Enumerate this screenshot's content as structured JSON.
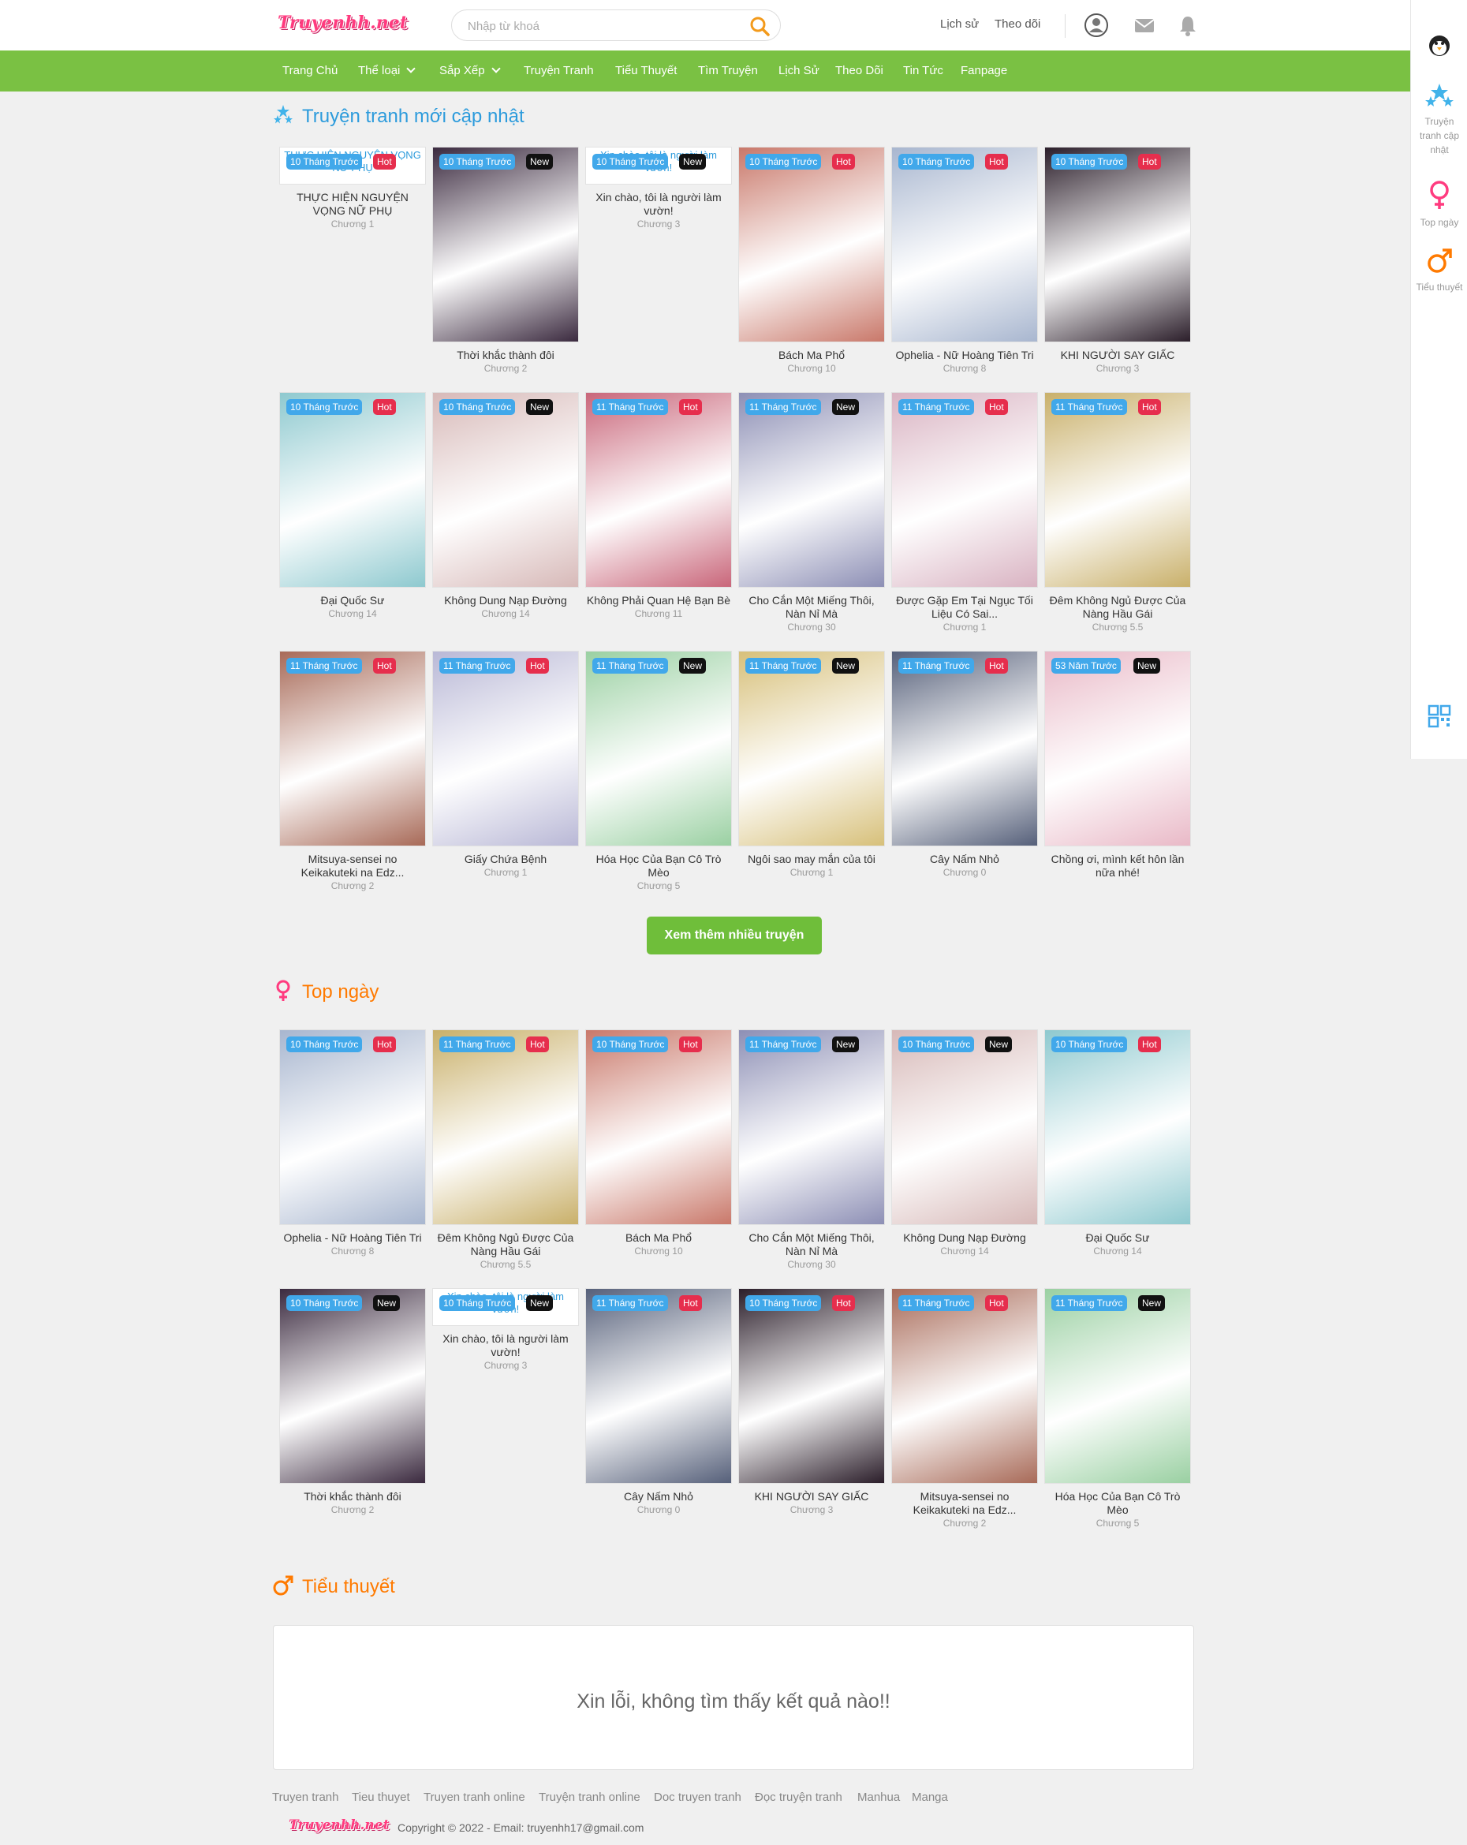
{
  "header": {
    "logo_text": "Truyenhh.net",
    "search_placeholder": "Nhập từ khoá",
    "history_label": "Lịch sử",
    "follow_label": "Theo dõi",
    "icons": [
      "user-icon",
      "mail-icon",
      "bell-icon",
      "search-icon"
    ]
  },
  "nav": {
    "items": [
      {
        "label": "Trang Chủ"
      },
      {
        "label": "Thể loại",
        "dropdown": true
      },
      {
        "label": "Sắp Xếp",
        "dropdown": true
      },
      {
        "label": "Truyện Tranh"
      },
      {
        "label": "Tiểu Thuyết"
      },
      {
        "label": "Tìm Truyện"
      },
      {
        "label": "Lịch Sử"
      },
      {
        "label": "Theo Dõi"
      },
      {
        "label": "Tin Tức"
      },
      {
        "label": "Fanpage"
      }
    ]
  },
  "sidebar": {
    "items": [
      {
        "label": "",
        "icon": "penguin-icon"
      },
      {
        "label": "Truyện tranh cập nhật",
        "icon": "stars-icon"
      },
      {
        "label": "Top ngày",
        "icon": "female-icon"
      },
      {
        "label": "Tiểu thuyết",
        "icon": "male-icon"
      },
      {
        "label": "",
        "icon": "qr-code-icon"
      }
    ]
  },
  "sections": {
    "latest": {
      "title": "Truyện tranh mới cập nhật",
      "more_label": "Xem thêm nhiều truyện"
    },
    "top": {
      "title": "Top ngày"
    },
    "novel": {
      "title": "Tiểu thuyết",
      "empty_message": "Xin lỗi, không tìm thấy kết quả nào!!"
    }
  },
  "latest_cards": [
    {
      "time": "10 Tháng Trước",
      "tag": "Hot",
      "title": "THỰC HIỆN NGUYỆN VỌNG NỮ PHỤ",
      "chapter": "Chương 1",
      "alt": "THỰC HIỆN NGUYỆN VỌNG NỮ PHỤ",
      "broken": true
    },
    {
      "time": "10 Tháng Trước",
      "tag": "New",
      "title": "Thời khắc thành đôi",
      "chapter": "Chương 2",
      "hue": "#3b2a3f"
    },
    {
      "time": "10 Tháng Trước",
      "tag": "New",
      "title": "Xin chào, tôi là người làm vườn!",
      "chapter": "Chương 3",
      "alt": "Xin chào, tôi là người làm vườn!",
      "broken": true
    },
    {
      "time": "10 Tháng Trước",
      "tag": "Hot",
      "title": "Bách Ma Phổ",
      "chapter": "Chương 10",
      "hue": "#c9786a"
    },
    {
      "time": "10 Tháng Trước",
      "tag": "Hot",
      "title": "Ophelia - Nữ Hoàng Tiên Tri",
      "chapter": "Chương 8",
      "hue": "#a8b6cf"
    },
    {
      "time": "10 Tháng Trước",
      "tag": "Hot",
      "title": "KHI NGƯỜI SAY GIẤC",
      "chapter": "Chương 3",
      "hue": "#2b1e2a"
    },
    {
      "time": "10 Tháng Trước",
      "tag": "Hot",
      "title": "Đại Quốc Sư",
      "chapter": "Chương 14",
      "hue": "#8ec9cf"
    },
    {
      "time": "10 Tháng Trước",
      "tag": "New",
      "title": "Không Dung Nạp Đường",
      "chapter": "Chương 14",
      "hue": "#d7b9b8"
    },
    {
      "time": "11 Tháng Trước",
      "tag": "Hot",
      "title": "Không Phải Quan Hệ Bạn Bè",
      "chapter": "Chương 11",
      "hue": "#c9667a"
    },
    {
      "time": "11 Tháng Trước",
      "tag": "New",
      "title": "Cho Cắn Một Miếng Thôi, Nàn Nỉ Mà",
      "chapter": "Chương 30",
      "hue": "#8d8fb5"
    },
    {
      "time": "11 Tháng Trước",
      "tag": "Hot",
      "title": "Được Gặp Em Tại Ngục Tối Liệu Có Sai...",
      "chapter": "Chương 1",
      "hue": "#d9b3c2"
    },
    {
      "time": "11 Tháng Trước",
      "tag": "Hot",
      "title": "Đêm Không Ngủ Được Của Nàng Hầu Gái",
      "chapter": "Chương 5.5",
      "hue": "#c9b06a"
    },
    {
      "time": "11 Tháng Trước",
      "tag": "Hot",
      "title": "Mitsuya-sensei no Keikakuteki na Edz...",
      "chapter": "Chương 2",
      "hue": "#a86a58"
    },
    {
      "time": "11 Tháng Trước",
      "tag": "Hot",
      "title": "Giấy Chứa Bệnh",
      "chapter": "Chương 1",
      "hue": "#b9b8d6"
    },
    {
      "time": "11 Tháng Trước",
      "tag": "New",
      "title": "Hóa Học Của Bạn Cô Trò Mèo",
      "chapter": "Chương 5",
      "hue": "#9ad0a2"
    },
    {
      "time": "11 Tháng Trước",
      "tag": "New",
      "title": "Ngôi sao may mắn của tôi",
      "chapter": "Chương 1",
      "hue": "#d7c07a"
    },
    {
      "time": "11 Tháng Trước",
      "tag": "Hot",
      "title": "Cây Nấm Nhỏ",
      "chapter": "Chương 0",
      "hue": "#56607a"
    },
    {
      "time": "53 Năm Trước",
      "tag": "New",
      "title": "Chồng ơi, mình kết hôn lần nữa nhé!",
      "chapter": "",
      "hue": "#e9b9c7"
    }
  ],
  "top_cards": [
    {
      "time": "10 Tháng Trước",
      "tag": "Hot",
      "title": "Ophelia - Nữ Hoàng Tiên Tri",
      "chapter": "Chương 8",
      "hue": "#a8b6cf"
    },
    {
      "time": "11 Tháng Trước",
      "tag": "Hot",
      "title": "Đêm Không Ngủ Được Của Nàng Hầu Gái",
      "chapter": "Chương 5.5",
      "hue": "#c9b06a"
    },
    {
      "time": "10 Tháng Trước",
      "tag": "Hot",
      "title": "Bách Ma Phổ",
      "chapter": "Chương 10",
      "hue": "#c9786a"
    },
    {
      "time": "11 Tháng Trước",
      "tag": "New",
      "title": "Cho Cắn Một Miếng Thôi, Nàn Nỉ Mà",
      "chapter": "Chương 30",
      "hue": "#8d8fb5"
    },
    {
      "time": "10 Tháng Trước",
      "tag": "New",
      "title": "Không Dung Nạp Đường",
      "chapter": "Chương 14",
      "hue": "#d7b9b8"
    },
    {
      "time": "10 Tháng Trước",
      "tag": "Hot",
      "title": "Đại Quốc Sư",
      "chapter": "Chương 14",
      "hue": "#8ec9cf"
    },
    {
      "time": "10 Tháng Trước",
      "tag": "New",
      "title": "Thời khắc thành đôi",
      "chapter": "Chương 2",
      "hue": "#3b2a3f"
    },
    {
      "time": "10 Tháng Trước",
      "tag": "New",
      "title": "Xin chào, tôi là người làm vườn!",
      "chapter": "Chương 3",
      "alt": "Xin chào, tôi là người làm vườn!",
      "broken": true
    },
    {
      "time": "11 Tháng Trước",
      "tag": "Hot",
      "title": "Cây Nấm Nhỏ",
      "chapter": "Chương 0",
      "hue": "#56607a"
    },
    {
      "time": "10 Tháng Trước",
      "tag": "Hot",
      "title": "KHI NGƯỜI SAY GIẤC",
      "chapter": "Chương 3",
      "hue": "#2b1e2a"
    },
    {
      "time": "11 Tháng Trước",
      "tag": "Hot",
      "title": "Mitsuya-sensei no Keikakuteki na Edz...",
      "chapter": "Chương 2",
      "hue": "#a86a58"
    },
    {
      "time": "11 Tháng Trước",
      "tag": "New",
      "title": "Hóa Học Của Bạn Cô Trò Mèo",
      "chapter": "Chương 5",
      "hue": "#9ad0a2"
    }
  ],
  "footer": {
    "links": [
      "Truyen tranh",
      "Tieu thuyet",
      "Truyen tranh online",
      "Truyện tranh online",
      "Doc truyen tranh",
      "Đọc truyện tranh",
      "Manhua",
      "Manga"
    ],
    "logo_text": "Truyenhh.net",
    "copyright": "Copyright © 2022 - Email: truyenhh17@gmail.com"
  },
  "colors": {
    "nav_green": "#7ac143",
    "section_blue": "#2c9bdc",
    "section_orange": "#ff7a00",
    "badge_time": "#41a8ea",
    "badge_hot": "#e62e4d",
    "badge_new": "#111111"
  }
}
